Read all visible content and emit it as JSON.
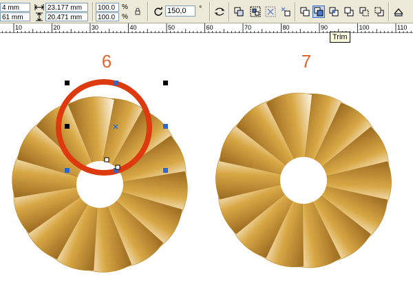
{
  "property_bar": {
    "x_position": "4 mm",
    "y_position": "61 mm",
    "width": "23.177 mm",
    "height": "20.471 mm",
    "scale_x": "100.0",
    "scale_y": "100.0",
    "percent_sign": "%",
    "rotation": "150,0",
    "degree_sign": "°"
  },
  "shaping_buttons": [
    {
      "name": "weld-button",
      "active": false
    },
    {
      "name": "trim-button",
      "active": true
    },
    {
      "name": "intersect-button",
      "active": false
    },
    {
      "name": "simplify-button",
      "active": false
    },
    {
      "name": "front-minus-back-button",
      "active": false
    },
    {
      "name": "back-minus-front-button",
      "active": false
    }
  ],
  "ruler": {
    "labels": [
      "10",
      "20",
      "30",
      "40",
      "50",
      "60",
      "70",
      "80",
      "90",
      "100",
      "110"
    ]
  },
  "tooltip": "Trim",
  "steps": {
    "left_number": "6",
    "right_number": "7"
  },
  "colors": {
    "step_number": "#e0662a",
    "highlight_ring": "#dd3a10",
    "gold_dark": "#8a5a18",
    "gold_mid": "#d8a845",
    "gold_light": "#fffaf0",
    "handle": "#000000",
    "handle_selected": "#2a6ad0"
  }
}
